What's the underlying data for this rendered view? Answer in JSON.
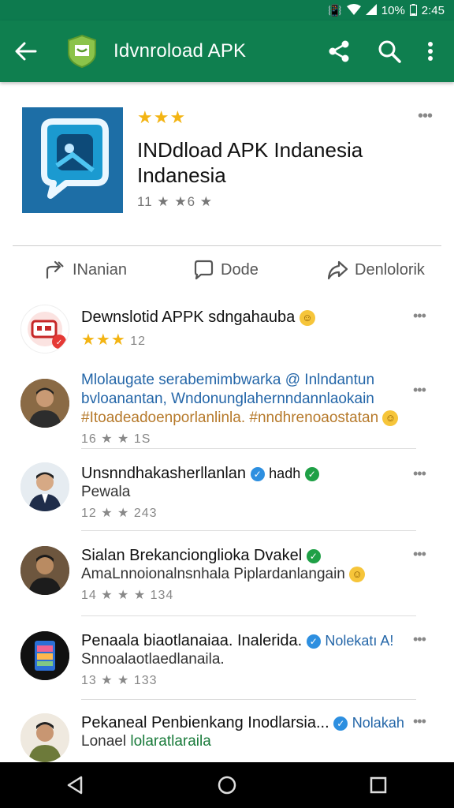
{
  "status_bar": {
    "battery": "10%",
    "time": "2:45"
  },
  "app_bar": {
    "title": "Idvnroload APK",
    "colors": {
      "bar": "#0f7f4f"
    }
  },
  "app_header": {
    "stars": "★★★",
    "name": "INDdload APK Indanesia Indanesia",
    "meta": "11 ★ ★6 ★",
    "more": "•••"
  },
  "actions": [
    {
      "icon": "share-arrow-icon",
      "label": "INanian"
    },
    {
      "icon": "comment-icon",
      "label": "Dode"
    },
    {
      "icon": "forward-icon",
      "label": "Denlolorik"
    }
  ],
  "list": [
    {
      "title": "Dewnslotid APPK sdngahauba",
      "lines": [],
      "stars": "★★★",
      "meta": "12",
      "verified": "",
      "more": "•••"
    },
    {
      "title": "",
      "lines": [
        {
          "text": "Mlolaugate serabemimbwarka @ Inlndantun",
          "style": "blue"
        },
        {
          "text": "bvloanantan, Wndonunglahernndannlaokain",
          "style": "blue"
        },
        {
          "text": "#Itoadeadoenporlanlinla. #nndhrenoaostatan",
          "style": "orange"
        }
      ],
      "meta": "16 ★ ★ 1S",
      "more": "•••"
    },
    {
      "title": "Unsnndhakasherllanlan",
      "title_suffix": "hadh",
      "lines": [
        {
          "text": "Pewala",
          "style": ""
        }
      ],
      "meta": "12 ★ ★ 243",
      "more": "•••"
    },
    {
      "title": "Sialan Brekancionglioka Dvakel",
      "lines": [
        {
          "text": "AmaLnnoionalnsnhala Piplardanlangain",
          "style": ""
        }
      ],
      "meta": "14 ★ ★ ★ 134",
      "more": "•••"
    },
    {
      "title": "Penaala biaotlanaiaa. Inalerida.",
      "title_suffix": "Nolekatı A!",
      "lines": [
        {
          "text": "Snnoalaotlaedlanaila.",
          "style": ""
        }
      ],
      "meta": "13 ★ ★ 133",
      "more": "•••"
    },
    {
      "title": "Pekaneal Penbienkang Inodlarsia...",
      "title_suffix": "Nolakah",
      "lines": [
        {
          "text": "Lonael",
          "style": "",
          "suffix": "lolaratlaraila"
        }
      ],
      "meta": "",
      "more": "•••"
    }
  ]
}
